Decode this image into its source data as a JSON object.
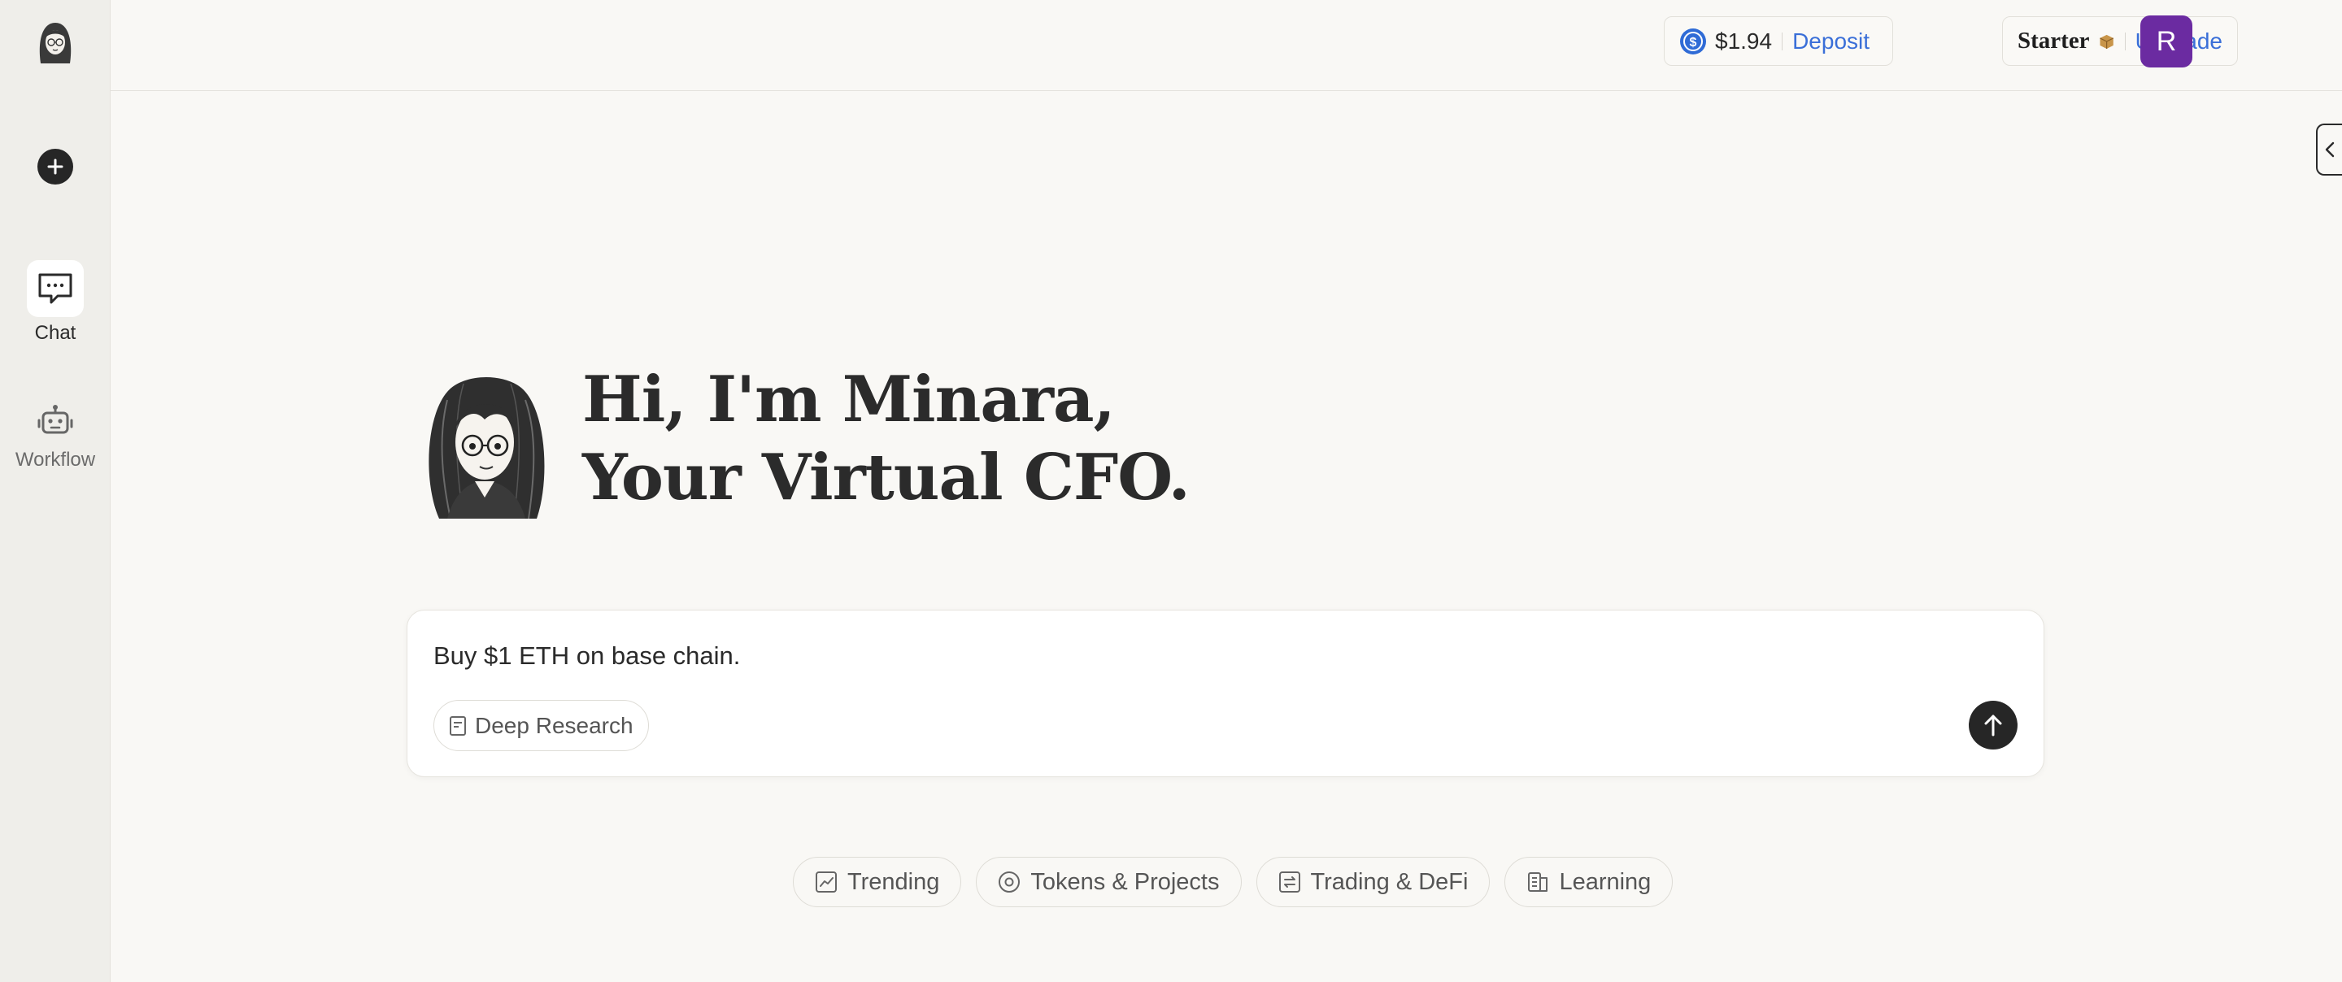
{
  "sidebar": {
    "logo_icon": "minara-avatar-icon",
    "new_chat_icon": "plus-icon",
    "items": [
      {
        "label": "Chat",
        "icon": "chat-bubble-icon",
        "active": true
      },
      {
        "label": "Workflow",
        "icon": "robot-icon",
        "active": false
      }
    ]
  },
  "header": {
    "balance": {
      "icon": "usdc-coin-icon",
      "amount": "$1.94",
      "action": "Deposit"
    },
    "plan": {
      "name": "Starter",
      "icon": "box-icon",
      "action": "Upgrade"
    },
    "user_initial": "R",
    "colors": {
      "link": "#3a6fd8",
      "avatar": "#6b2ba1"
    }
  },
  "hero": {
    "line1": "Hi, I'm Minara,",
    "line2": "Your Virtual CFO."
  },
  "composer": {
    "value": "Buy $1 ETH on base chain.",
    "deep_research_label": "Deep Research",
    "send_icon": "arrow-up-icon"
  },
  "suggestions": [
    {
      "label": "Trending",
      "icon": "trend-chart-icon"
    },
    {
      "label": "Tokens & Projects",
      "icon": "target-icon"
    },
    {
      "label": "Trading & DeFi",
      "icon": "swap-icon"
    },
    {
      "label": "Learning",
      "icon": "book-icon"
    }
  ]
}
